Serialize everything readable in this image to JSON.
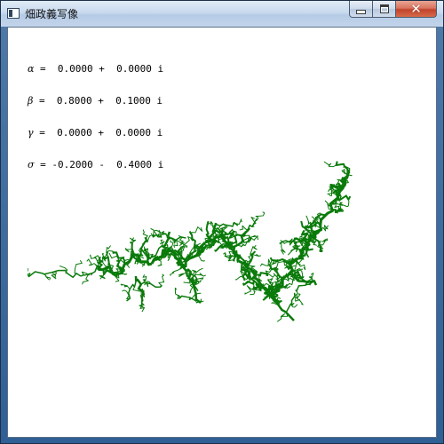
{
  "window": {
    "title": "畑政義写像",
    "controls": {
      "minimize": "minimize",
      "maximize": "maximize",
      "close": "close",
      "close_glyph": "✕"
    },
    "icon": "app-window-icon"
  },
  "parameters": [
    {
      "symbol": "α",
      "text": " =  0.0000 +  0.0000 i"
    },
    {
      "symbol": "β",
      "text": " =  0.8000 +  0.1000 i"
    },
    {
      "symbol": "γ",
      "text": " =  0.0000 +  0.0000 i"
    },
    {
      "symbol": "σ",
      "text": " = -0.2000 -  0.4000 i"
    }
  ],
  "fractal": {
    "color": "#0a7a0a"
  }
}
